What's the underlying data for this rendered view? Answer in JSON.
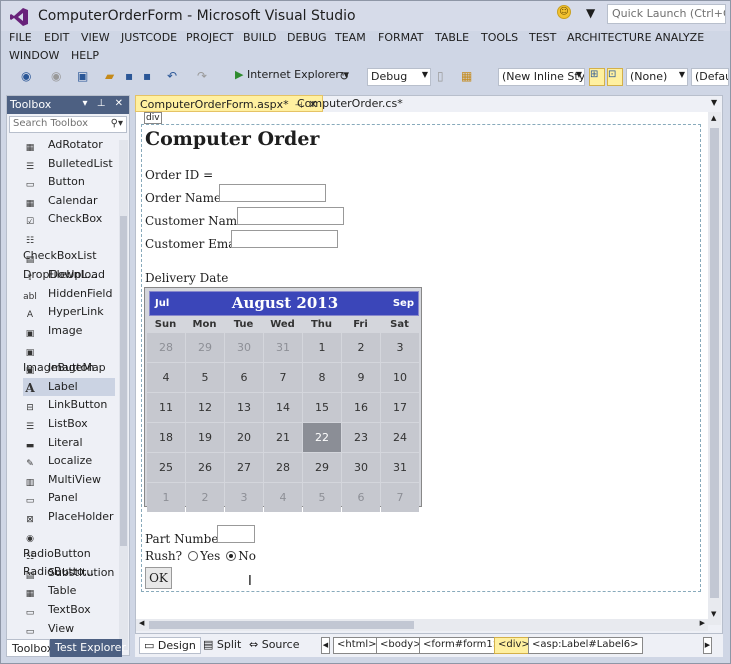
{
  "window": {
    "title": "ComputerOrderForm - Microsoft Visual Studio",
    "quick_launch_placeholder": "Quick Launch (Ctrl+Q)"
  },
  "menu": [
    "FILE",
    "EDIT",
    "VIEW",
    "JUSTCODE",
    "PROJECT",
    "BUILD",
    "DEBUG",
    "TEAM",
    "FORMAT",
    "TABLE",
    "TOOLS",
    "TEST",
    "ARCHITECTURE",
    "ANALYZE",
    "WINDOW",
    "HELP"
  ],
  "toolbar": {
    "run_target": "Internet Explorer",
    "config": "Debug",
    "style_combo": "(New Inline Style",
    "target_combo": "(None)",
    "default_combo": "(Defaul"
  },
  "toolbox": {
    "title": "Toolbox",
    "search_placeholder": "Search Toolbox",
    "items": [
      {
        "label": "AdRotator",
        "icon": "adrotator-icon"
      },
      {
        "label": "BulletedList",
        "icon": "bulleted-list-icon"
      },
      {
        "label": "Button",
        "icon": "button-icon"
      },
      {
        "label": "Calendar",
        "icon": "calendar-icon"
      },
      {
        "label": "CheckBox",
        "icon": "checkbox-icon"
      },
      {
        "label": "CheckBoxList",
        "icon": "checkbox-list-icon"
      },
      {
        "label": "DropDownL...",
        "icon": "dropdown-icon"
      },
      {
        "label": "FileUpload",
        "icon": "file-upload-icon"
      },
      {
        "label": "HiddenField",
        "icon": "hidden-field-icon"
      },
      {
        "label": "HyperLink",
        "icon": "hyperlink-icon"
      },
      {
        "label": "Image",
        "icon": "image-icon"
      },
      {
        "label": "ImageButton",
        "icon": "image-button-icon"
      },
      {
        "label": "ImageMap",
        "icon": "image-map-icon"
      },
      {
        "label": "Label",
        "icon": "label-icon"
      },
      {
        "label": "LinkButton",
        "icon": "link-button-icon"
      },
      {
        "label": "ListBox",
        "icon": "listbox-icon"
      },
      {
        "label": "Literal",
        "icon": "literal-icon"
      },
      {
        "label": "Localize",
        "icon": "localize-icon"
      },
      {
        "label": "MultiView",
        "icon": "multiview-icon"
      },
      {
        "label": "Panel",
        "icon": "panel-icon"
      },
      {
        "label": "PlaceHolder",
        "icon": "placeholder-icon"
      },
      {
        "label": "RadioButton",
        "icon": "radio-button-icon"
      },
      {
        "label": "RadioButto...",
        "icon": "radio-button-list-icon"
      },
      {
        "label": "Substitution",
        "icon": "substitution-icon"
      },
      {
        "label": "Table",
        "icon": "table-icon"
      },
      {
        "label": "TextBox",
        "icon": "textbox-icon"
      },
      {
        "label": "View",
        "icon": "view-icon"
      }
    ],
    "selected": "Label"
  },
  "bottom_tabs": {
    "toolbox": "Toolbox",
    "test_explorer": "Test Explorer"
  },
  "doc_tabs": {
    "active": "ComputerOrderForm.aspx*",
    "inactive": "ComputerOrder.cs*"
  },
  "design": {
    "div_tag": "div",
    "heading": "Computer Order",
    "order_id": "Order ID =",
    "order_name": "Order Name:",
    "customer_name": "Customer Name:",
    "customer_email": "Customer Email:",
    "delivery_date": "Delivery Date",
    "part_number": "Part Number:",
    "rush": "Rush?",
    "rush_yes": "Yes",
    "rush_no": "No",
    "ok_button": "OK"
  },
  "calendar": {
    "prev": "Jul",
    "title": "August 2013",
    "next": "Sep",
    "days": [
      "Sun",
      "Mon",
      "Tue",
      "Wed",
      "Thu",
      "Fri",
      "Sat"
    ],
    "weeks": [
      [
        "28",
        "29",
        "30",
        "31",
        "1",
        "2",
        "3"
      ],
      [
        "4",
        "5",
        "6",
        "7",
        "8",
        "9",
        "10"
      ],
      [
        "11",
        "12",
        "13",
        "14",
        "15",
        "16",
        "17"
      ],
      [
        "18",
        "19",
        "20",
        "21",
        "22",
        "23",
        "24"
      ],
      [
        "25",
        "26",
        "27",
        "28",
        "29",
        "30",
        "31"
      ],
      [
        "1",
        "2",
        "3",
        "4",
        "5",
        "6",
        "7"
      ]
    ],
    "selected_day": "22"
  },
  "view_bar": {
    "design": "Design",
    "split": "Split",
    "source": "Source",
    "breadcrumbs": [
      "<html>",
      "<body>",
      "<form#form1>",
      "<div>",
      "<asp:Label#Label6>"
    ]
  }
}
